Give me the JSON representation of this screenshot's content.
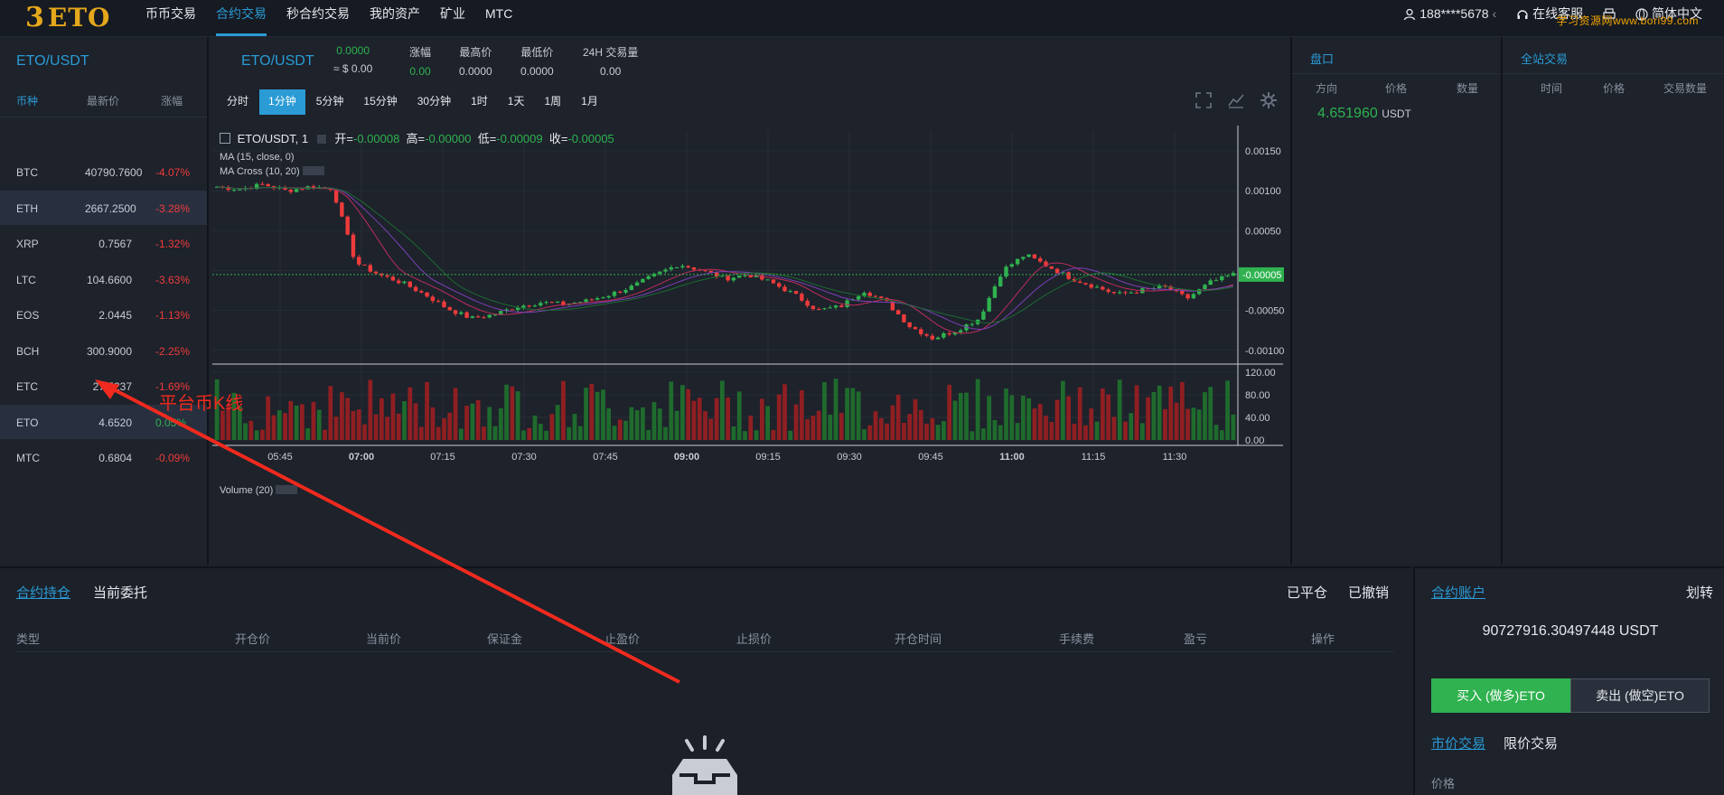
{
  "brand": {
    "logo_mark": "3",
    "logo_word": "ETO"
  },
  "nav": {
    "items": [
      {
        "label": "币币交易"
      },
      {
        "label": "合约交易",
        "active": true
      },
      {
        "label": "秒合约交易"
      },
      {
        "label": "我的资产"
      },
      {
        "label": "矿业"
      },
      {
        "label": "MTC"
      }
    ]
  },
  "user": {
    "account": "188****5678",
    "support": "在线客服",
    "language": "简体中文"
  },
  "watermark": "学习资源网www.bori99.com",
  "market": {
    "title": "ETO/USDT",
    "headers": {
      "coin": "币种",
      "price": "最新价",
      "change": "涨幅"
    },
    "rows": [
      {
        "coin": "BTC",
        "price": "40790.7600",
        "change": "-4.07%",
        "dir": "dn"
      },
      {
        "coin": "ETH",
        "price": "2667.2500",
        "change": "-3.28%",
        "dir": "dn",
        "selected": true
      },
      {
        "coin": "XRP",
        "price": "0.7567",
        "change": "-1.32%",
        "dir": "dn"
      },
      {
        "coin": "LTC",
        "price": "104.6600",
        "change": "-3.63%",
        "dir": "dn"
      },
      {
        "coin": "EOS",
        "price": "2.0445",
        "change": "-1.13%",
        "dir": "dn"
      },
      {
        "coin": "BCH",
        "price": "300.9000",
        "change": "-2.25%",
        "dir": "dn"
      },
      {
        "coin": "ETC",
        "price": "27.5237",
        "change": "-1.69%",
        "dir": "dn"
      },
      {
        "coin": "ETO",
        "price": "4.6520",
        "change": "0.05%",
        "dir": "up",
        "selected": true
      },
      {
        "coin": "MTC",
        "price": "0.6804",
        "change": "-0.09%",
        "dir": "dn"
      }
    ]
  },
  "ticker": {
    "pair": "ETO/USDT",
    "last": "0.0000",
    "last_usd": "≈ $ 0.00",
    "change_label": "涨幅",
    "change": "0.00",
    "high_label": "最高价",
    "high": "0.0000",
    "low_label": "最低价",
    "low": "0.0000",
    "vol_label": "24H 交易量",
    "vol": "0.00"
  },
  "intervals": [
    "分时",
    "1分钟",
    "5分钟",
    "15分钟",
    "30分钟",
    "1时",
    "1天",
    "1周",
    "1月"
  ],
  "active_interval": "1分钟",
  "legend": {
    "symbol": "ETO/USDT, 1",
    "open_label": "开=",
    "open": "-0.00008",
    "high_label": "高=",
    "high": "-0.00000",
    "low_label": "低=",
    "low": "-0.00009",
    "close_label": "收=",
    "close": "-0.00005",
    "ma": "MA (15, close, 0)",
    "macross": "MA Cross (10, 20)",
    "volume": "Volume (20)"
  },
  "chart_data": {
    "type": "candlestick",
    "price_axis": {
      "ticks": [
        "0.00150",
        "0.00100",
        "0.00050",
        "0.00000",
        "-0.00050",
        "-0.00100"
      ],
      "range": [
        -0.00115,
        0.00175
      ],
      "last_label": "-0.00005",
      "last_value": -5e-05
    },
    "volume_axis": {
      "ticks": [
        "120.00",
        "80.00",
        "40.00",
        "0.00"
      ],
      "range": [
        0,
        125
      ]
    },
    "time_ticks": [
      {
        "label": "05:45",
        "bold": false
      },
      {
        "label": "07:00",
        "bold": true
      },
      {
        "label": "07:15",
        "bold": false
      },
      {
        "label": "07:30",
        "bold": false
      },
      {
        "label": "07:45",
        "bold": false
      },
      {
        "label": "09:00",
        "bold": true
      },
      {
        "label": "09:15",
        "bold": false
      },
      {
        "label": "09:30",
        "bold": false
      },
      {
        "label": "09:45",
        "bold": false
      },
      {
        "label": "11:00",
        "bold": true
      },
      {
        "label": "11:15",
        "bold": false
      },
      {
        "label": "11:30",
        "bold": false
      }
    ],
    "close_path": [
      0.00105,
      0.00102,
      0.00108,
      0.001,
      0.00105,
      0.00103,
      0.0001,
      -5e-05,
      -0.00015,
      -0.0003,
      -0.00048,
      -0.0006,
      -0.00055,
      -0.00045,
      -0.0004,
      -0.00042,
      -0.00038,
      -0.0003,
      -0.0002,
      -5e-05,
      8e-05,
      0.0,
      -0.0001,
      -5e-05,
      -0.00015,
      -0.0003,
      -0.0005,
      -0.00045,
      -0.00025,
      -0.0004,
      -0.0007,
      -0.00085,
      -0.00075,
      -0.0006,
      0.0,
      0.0002,
      5e-05,
      -0.0001,
      -0.0002,
      -0.0003,
      -0.00025,
      -0.0002,
      -0.00035,
      -0.00015,
      -5e-05
    ]
  },
  "orderbook": {
    "title": "盘口",
    "headers": [
      "方向",
      "价格",
      "数量"
    ],
    "price": "4.651960",
    "unit": "USDT"
  },
  "trades": {
    "title": "全站交易",
    "headers": [
      "时间",
      "价格",
      "交易数量"
    ]
  },
  "positions": {
    "tab_holding": "合约持仓",
    "tab_orders": "当前委托",
    "closed": "已平仓",
    "cancelled": "已撤销",
    "columns": [
      "类型",
      "开仓价",
      "当前价",
      "保证金",
      "止盈价",
      "止损价",
      "开仓时间",
      "手续费",
      "盈亏",
      "操作"
    ]
  },
  "account": {
    "title": "合约账户",
    "transfer": "划转",
    "balance": "90727916.30497448 USDT",
    "buy_label": "买入 (做多)ETO",
    "sell_label": "卖出 (做空)ETO",
    "tab_market": "市价交易",
    "tab_limit": "限价交易",
    "price_label": "价格"
  },
  "annotation": {
    "text": "平台币K线"
  },
  "colors": {
    "accent": "#2b9bd5",
    "up": "#2fb24f",
    "down": "#ef3b3b",
    "brand": "#e5a81c"
  }
}
